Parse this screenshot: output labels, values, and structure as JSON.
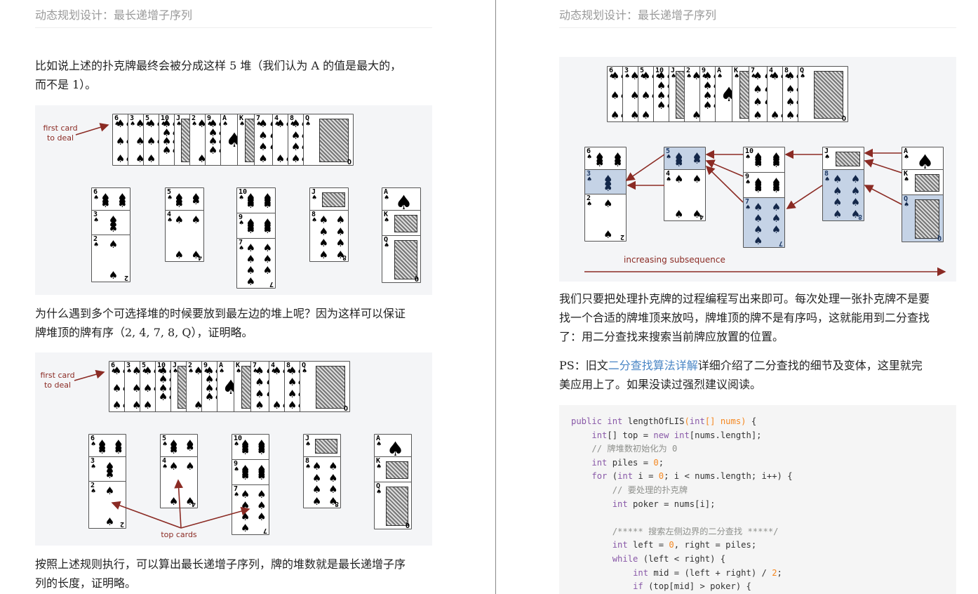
{
  "header": {
    "title": "动态规划设计：最长递增子序列"
  },
  "left": {
    "para1": "比如说上述的扑克牌最终会被分成这样 5 堆（我们认为 A 的值是最大的，而不是 1）。",
    "para1_line1": "比如说上述的扑克牌最终会被分成这样 5 堆（我们认为 A 的值是最大的，",
    "para1_line2": "而不是 1）。",
    "para2_line1": "为什么遇到多个可选择堆的时候要放到最左边的堆上呢？因为这样可以保证",
    "para2_line2": "牌堆顶的牌有序（2, 4, 7, 8, Q），证明略。",
    "para3_line1": "按照上述规则执行，可以算出最长递增子序列，牌的堆数就是最长递增子序",
    "para3_line2": "列的长度，证明略。",
    "fig1": {
      "label_first_card_line1": "first card",
      "label_first_card_line2": "to deal"
    },
    "fig2": {
      "label_first_card_line1": "first card",
      "label_first_card_line2": "to deal",
      "label_top_cards": "top cards"
    }
  },
  "right": {
    "fig3": {
      "label_increasing": "increasing subsequence"
    },
    "para4_line1": "我们只要把处理扑克牌的过程编程写出来即可。每次处理一张扑克牌不是要",
    "para4_line2": "找一个合适的牌堆顶来放吗，牌堆顶的牌不是有序吗，这就能用到二分查找",
    "para4_line3": "了：用二分查找来搜索当前牌应放置的位置。",
    "ps_prefix": "PS：旧文",
    "ps_link": "二分查找算法详解",
    "ps_suffix_line1": "详细介绍了二分查找的细节及变体，这里就完",
    "ps_line2": "美应用上了。如果没读过强烈建议阅读。",
    "code_lines": [
      "public int lengthOfLIS(int[] nums) {",
      "    int[] top = new int[nums.length];",
      "    // 牌堆数初始化为 0",
      "    int piles = 0;",
      "    for (int i = 0; i < nums.length; i++) {",
      "        // 要处理的扑克牌",
      "        int poker = nums[i];",
      "",
      "        /***** 搜索左侧边界的二分查找 *****/",
      "        int left = 0, right = piles;",
      "        while (left < right) {",
      "            int mid = (left + right) / 2;",
      "            if (top[mid] > poker) {"
    ]
  },
  "deal_sequence": [
    "6",
    "3",
    "5",
    "10",
    "J",
    "2",
    "9",
    "A",
    "K",
    "7",
    "4",
    "8",
    "Q"
  ],
  "piles": [
    [
      "6",
      "3",
      "2"
    ],
    [
      "5",
      "4"
    ],
    [
      "10",
      "9",
      "7"
    ],
    [
      "J",
      "8"
    ],
    [
      "A",
      "K",
      "Q"
    ]
  ],
  "top_cards": [
    "2",
    "4",
    "7",
    "8",
    "Q"
  ],
  "highlighted_subsequence": [
    "3",
    "5",
    "7",
    "8",
    "Q"
  ],
  "colors": {
    "annotation": "#8b2b24",
    "highlight": "#c5d3e6",
    "figure_bg": "#f4f5f7",
    "link": "#4a86c5"
  }
}
